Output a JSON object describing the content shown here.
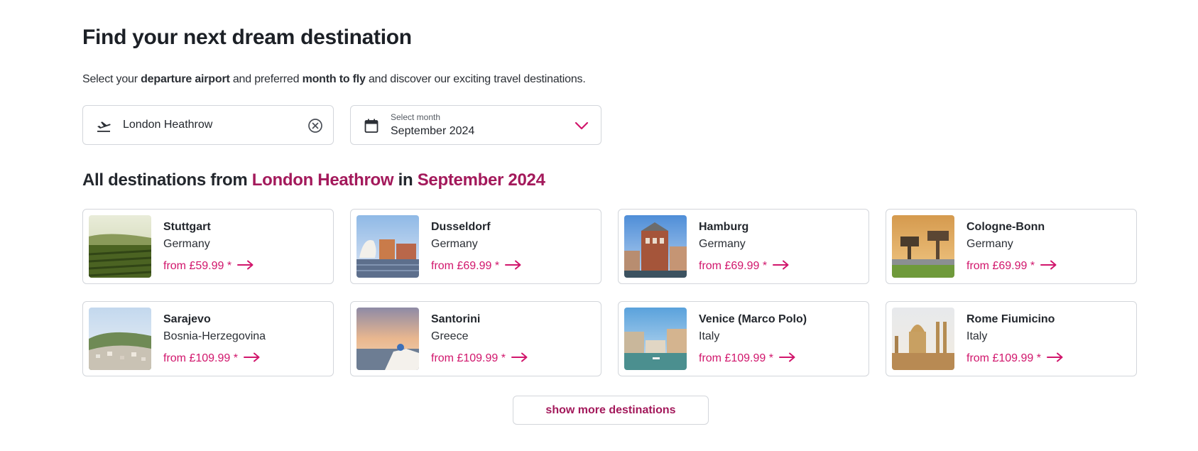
{
  "header": {
    "title": "Find your next dream destination",
    "intro_1": "Select your ",
    "intro_bold_1": "departure airport",
    "intro_2": " and preferred ",
    "intro_bold_2": "month to fly",
    "intro_3": " and discover our exciting travel destinations."
  },
  "airport_field": {
    "value": "London Heathrow",
    "icon": "plane-departure-icon",
    "clear_icon": "clear-circle-icon"
  },
  "month_field": {
    "label": "Select month",
    "value": "September 2024",
    "icon": "calendar-icon",
    "dropdown_icon": "chevron-down-icon"
  },
  "results": {
    "prefix": "All destinations from ",
    "airport": "London Heathrow",
    "middle": " in ",
    "month": "September 2024"
  },
  "destinations": [
    {
      "city": "Stuttgart",
      "country": "Germany",
      "price": "from £59.99 *"
    },
    {
      "city": "Dusseldorf",
      "country": "Germany",
      "price": "from £69.99 *"
    },
    {
      "city": "Hamburg",
      "country": "Germany",
      "price": "from £69.99 *"
    },
    {
      "city": "Cologne-Bonn",
      "country": "Germany",
      "price": "from £69.99 *"
    },
    {
      "city": "Sarajevo",
      "country": "Bosnia-Herzegovina",
      "price": "from £109.99 *"
    },
    {
      "city": "Santorini",
      "country": "Greece",
      "price": "from £109.99 *"
    },
    {
      "city": "Venice (Marco Polo)",
      "country": "Italy",
      "price": "from £109.99 *"
    },
    {
      "city": "Rome Fiumicino",
      "country": "Italy",
      "price": "from £109.99 *"
    }
  ],
  "show_more_label": "show more destinations",
  "colors": {
    "accent": "#a3195b",
    "price": "#d1166c",
    "text": "#23272d",
    "border": "#d3d6db"
  }
}
